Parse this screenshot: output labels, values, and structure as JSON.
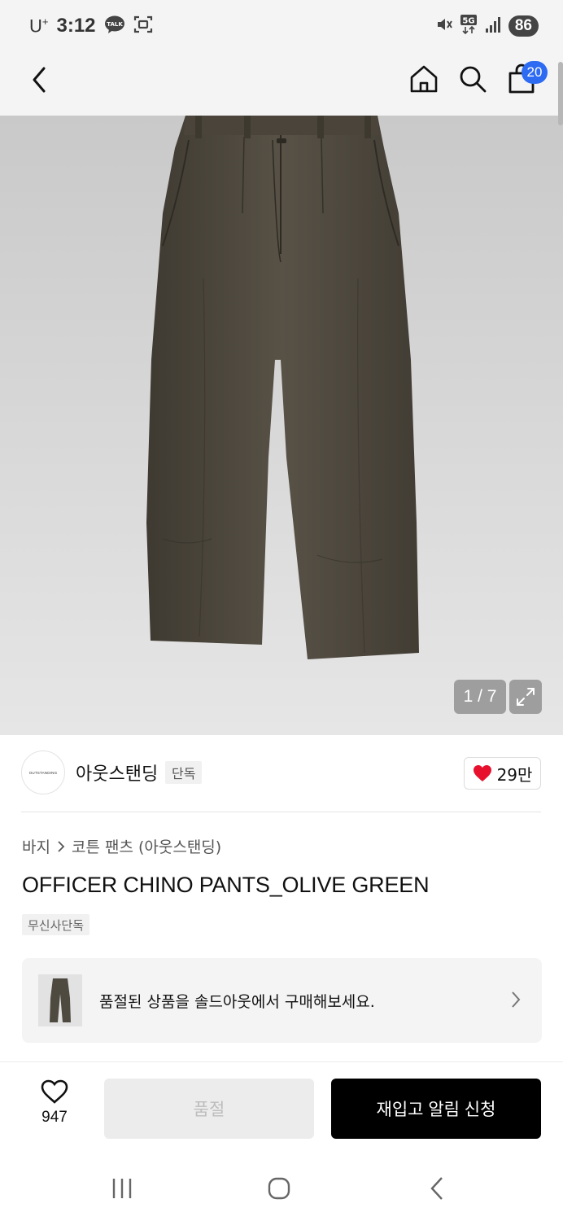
{
  "status_bar": {
    "carrier": "U",
    "carrier_sup": "+",
    "time": "3:12",
    "network": "5G",
    "battery": "86",
    "icons": [
      "kakaotalk-icon",
      "screenshot-icon",
      "mute-icon",
      "5g-data-icon",
      "signal-icon",
      "battery-icon"
    ]
  },
  "nav": {
    "cart_badge": "20",
    "icons": [
      "back-icon",
      "home-icon",
      "search-icon",
      "shopping-bag-icon"
    ]
  },
  "gallery": {
    "counter": "1 / 7",
    "current": 1,
    "total": 7,
    "product_color": "#4f4a40"
  },
  "brand": {
    "logo_text": "OUTSTANDING",
    "name": "아웃스탠딩",
    "tag": "단독",
    "likes": "29만"
  },
  "breadcrumb": {
    "category": "바지",
    "subcategory": "코튼 팬츠 (아웃스탠딩)"
  },
  "product": {
    "title": "OFFICER CHINO PANTS_OLIVE GREEN",
    "badge": "무신사단독"
  },
  "soldout_card": {
    "text": "품절된 상품을 솔드아웃에서 구매해보세요."
  },
  "actions": {
    "wish_count": "947",
    "soldout_label": "품절",
    "restock_label": "재입고 알림 신청"
  },
  "colors": {
    "accent_badge": "#2d6bf3",
    "heart": "#e8112d",
    "primary_button": "#000000",
    "disabled_button": "#ececec"
  }
}
